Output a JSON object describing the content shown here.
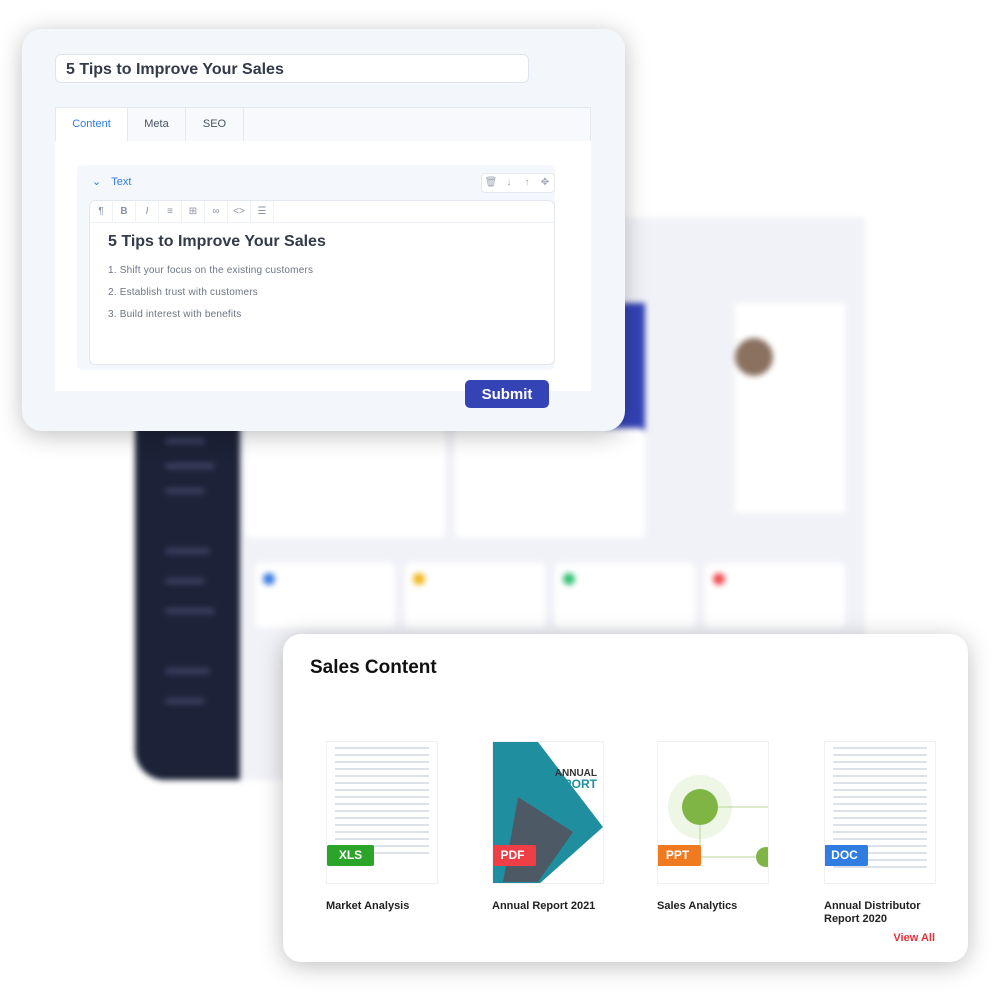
{
  "editor_card": {
    "title_value": "5 Tips to Improve Your Sales",
    "tabs": [
      {
        "label": "Content",
        "active": true
      },
      {
        "label": "Meta"
      },
      {
        "label": "SEO"
      }
    ],
    "block": {
      "label": "Text",
      "actions": [
        "trash-icon",
        "arrow-down-icon",
        "arrow-up-icon",
        "move-icon"
      ],
      "toolbar": [
        "paragraph-icon",
        "bold-icon",
        "italic-icon",
        "list-icon",
        "table-icon",
        "link-icon",
        "code-icon",
        "align-icon"
      ],
      "heading": "5 Tips to Improve Your Sales",
      "items": [
        "1. Shift your focus on the existing customers",
        "2. Establish trust with customers",
        "3. Build interest with benefits"
      ]
    },
    "submit_label": "Submit",
    "accent": "#3443b6"
  },
  "sales_content": {
    "title": "Sales Content",
    "items": [
      {
        "name": "Market Analysis",
        "type": "XLS",
        "color": "#2aa52a"
      },
      {
        "name": "Annual Report 2021",
        "type": "PDF",
        "color": "#ef3e45",
        "cover_text": "ANNUAL REPORT"
      },
      {
        "name": "Sales Analytics",
        "type": "PPT",
        "color": "#f07a1f"
      },
      {
        "name": "Annual Distributor Report 2020",
        "type": "DOC",
        "color": "#2f7de1"
      }
    ],
    "view_all": "View All"
  }
}
